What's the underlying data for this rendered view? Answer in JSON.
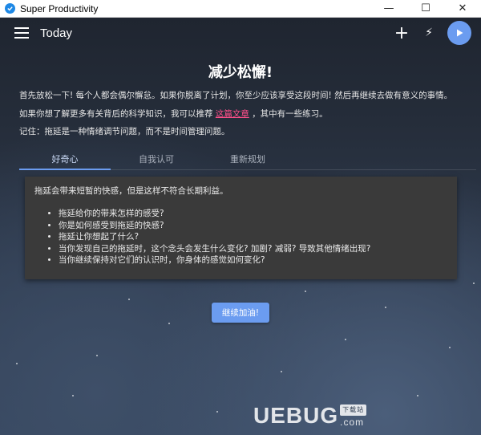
{
  "window": {
    "title": "Super Productivity",
    "minimize_icon": "—",
    "maximize_icon": "☐",
    "close_icon": "✕"
  },
  "toolbar": {
    "page_title": "Today",
    "add_icon": "+",
    "flash_icon": "⚡",
    "play_icon": "▶"
  },
  "content": {
    "heading": "减少松懈!",
    "para1": "首先放松一下! 每个人都会偶尔懈怠。如果你脱离了计划，你至少应该享受这段时间! 然后再继续去做有意义的事情。",
    "para2_before": "如果你想了解更多有关背后的科学知识，我可以推荐",
    "para2_link": "这篇文章",
    "para2_after": "，其中有一些练习。",
    "para3": "记住：拖延是一种情绪调节问题，而不是时间管理问题。"
  },
  "tabs": [
    {
      "label": "好奇心",
      "active": true
    },
    {
      "label": "自我认可",
      "active": false
    },
    {
      "label": "重新规划",
      "active": false
    }
  ],
  "card": {
    "intro": "拖延会带来短暂的快感，但是这样不符合长期利益。",
    "items": [
      "拖延给你的带来怎样的感受?",
      "你是如何感受到拖延的快感?",
      "拖延让你想起了什么?",
      "当你发现自己的拖延时，这个念头会发生什么变化? 加剧? 减弱? 导致其他情绪出现?",
      "当你继续保持对它们的认识时，你身体的感觉如何变化?"
    ]
  },
  "continue_button": "继续加油!",
  "watermark": {
    "brand": "UEBUG",
    "tag": "下载站",
    "domain": ".com"
  },
  "colors": {
    "accent": "#6b9cf0",
    "link": "#ff4f8a",
    "card_bg": "#3a3a3a"
  }
}
